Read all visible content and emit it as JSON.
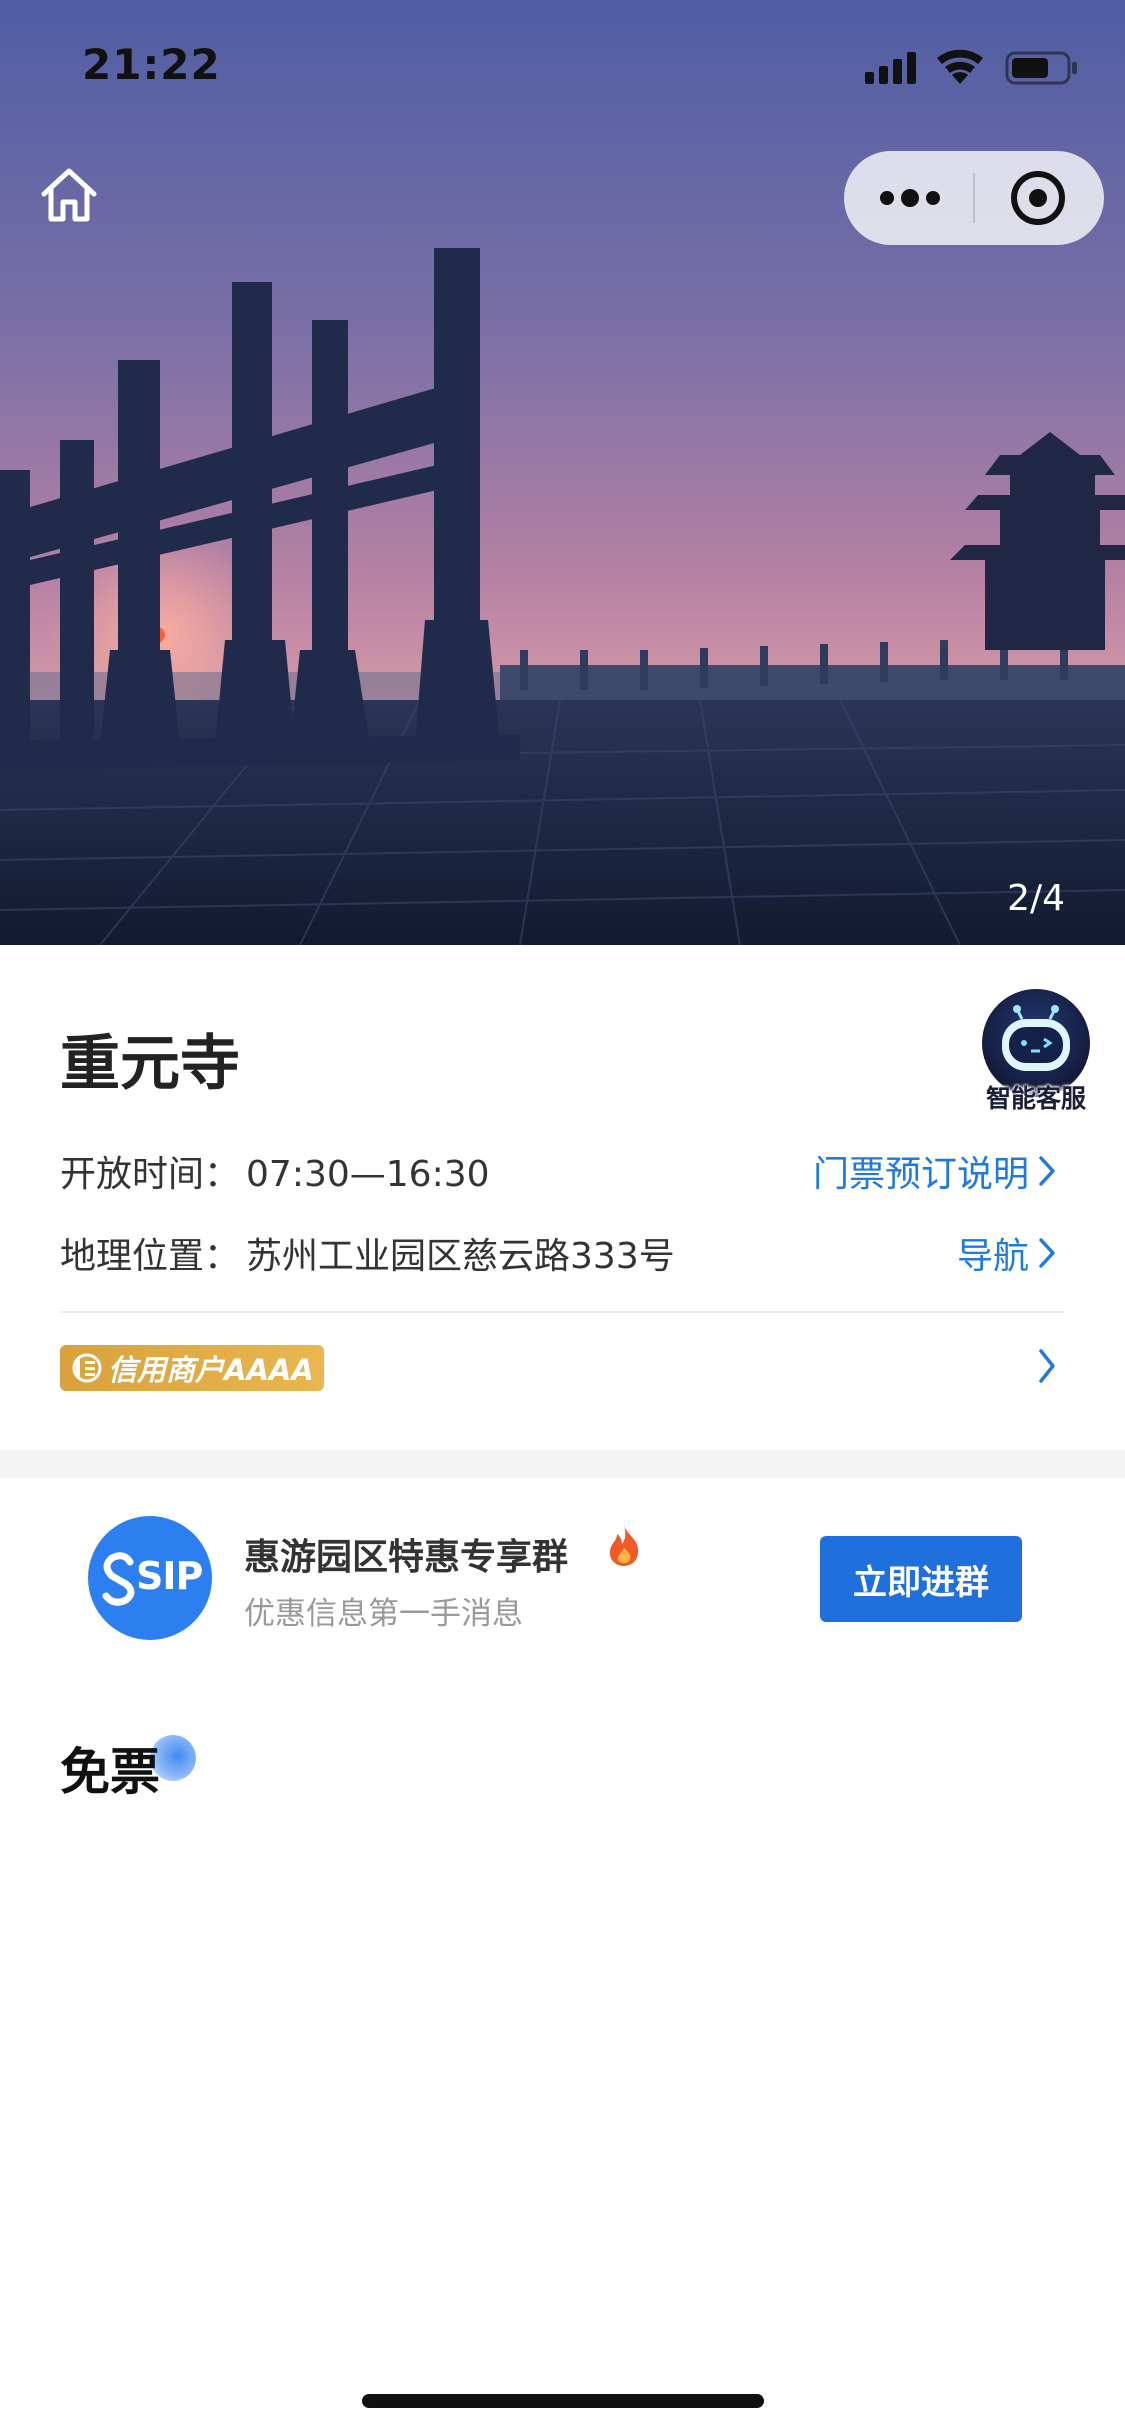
{
  "status_bar": {
    "time": "21:22"
  },
  "hero": {
    "photo_counter": "2/4"
  },
  "attraction": {
    "name": "重元寺",
    "open_time_label": "开放时间：",
    "open_time_value": "07:30—16:30",
    "location_label": "地理位置：",
    "location_value": "苏州工业园区慈云路333号",
    "ticket_info_link": "门票预订说明",
    "navigate_link": "导航",
    "credit_badge": "信用商户AAAA"
  },
  "ai_service": {
    "label": "智能客服"
  },
  "group_promo": {
    "logo_text": "SIP",
    "title": "惠游园区特惠专享群",
    "subtitle": "优惠信息第一手消息",
    "join_button": "立即进群"
  },
  "section": {
    "title": "免票"
  },
  "colors": {
    "link_blue": "#1f7ae0",
    "button_blue": "#1f6fdc",
    "badge_gold": "#e0ac45"
  }
}
